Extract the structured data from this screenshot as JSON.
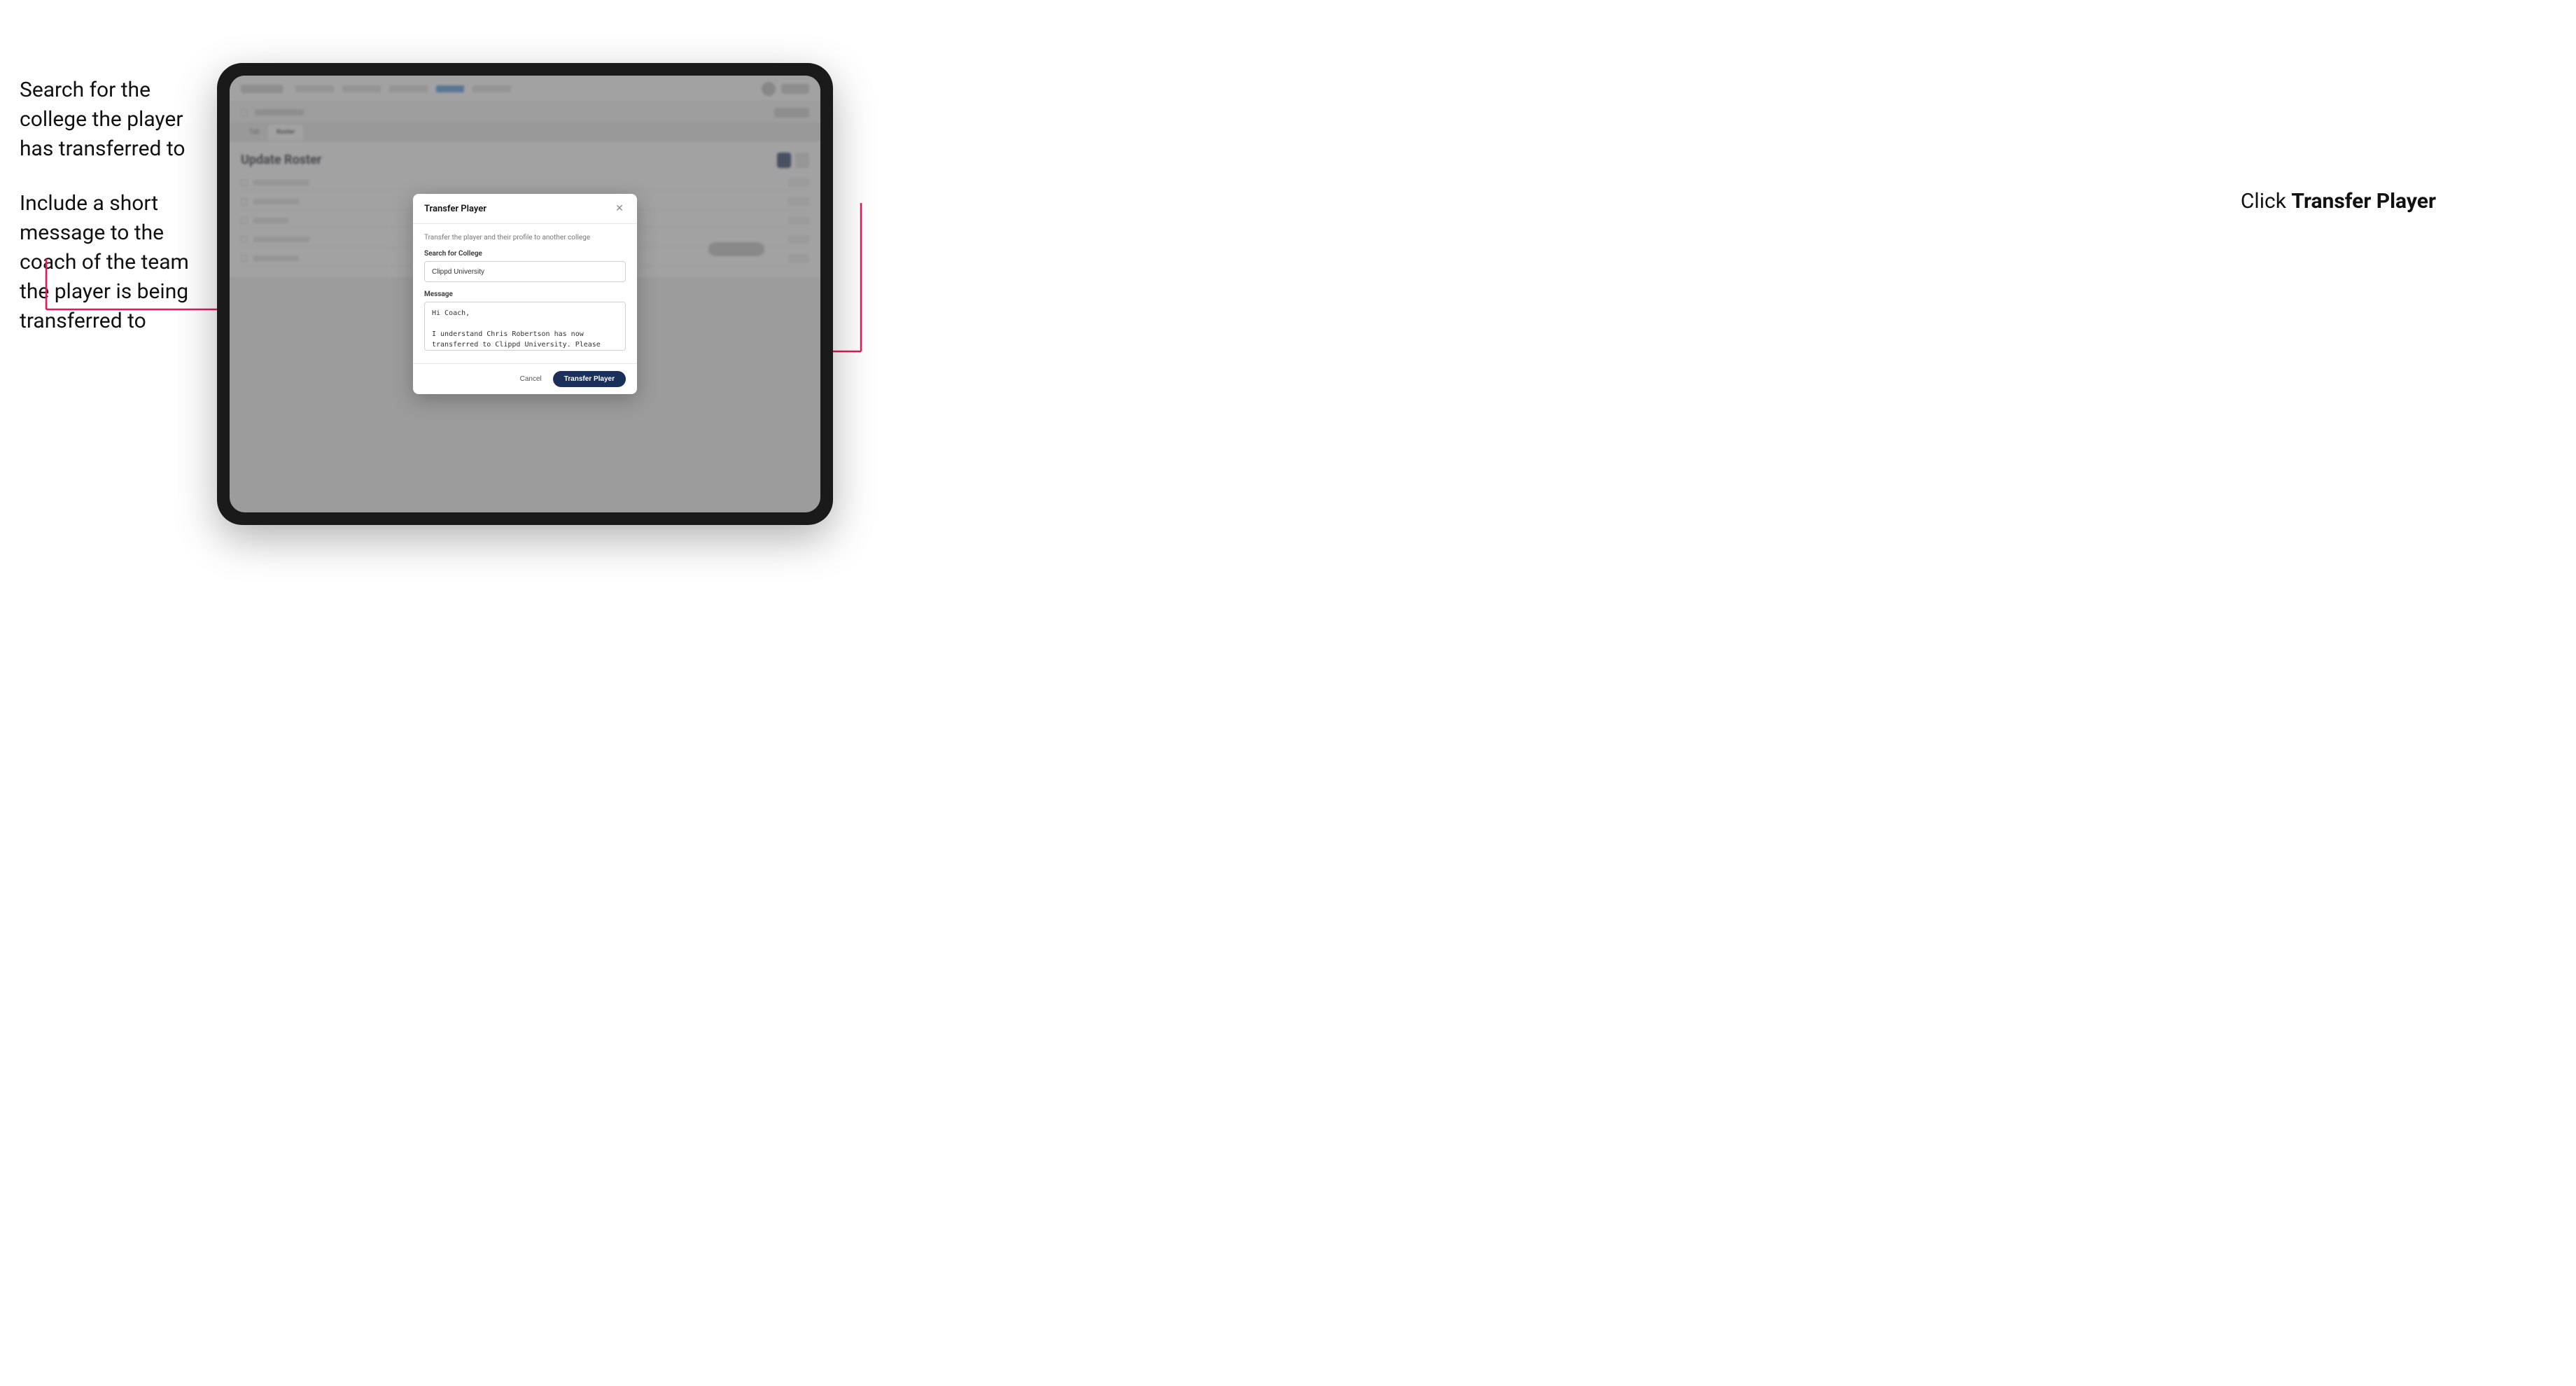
{
  "annotations": {
    "left_top": "Search for the college the player has transferred to",
    "left_bottom": "Include a short message to the coach of the team the player is being transferred to",
    "right": "Click",
    "right_bold": "Transfer Player"
  },
  "modal": {
    "title": "Transfer Player",
    "subtitle": "Transfer the player and their profile to another college",
    "search_label": "Search for College",
    "search_value": "Clippd University",
    "message_label": "Message",
    "message_value": "Hi Coach,\n\nI understand Chris Robertson has now transferred to Clippd University. Please accept this transfer request when you can.",
    "cancel_btn": "Cancel",
    "transfer_btn": "Transfer Player"
  },
  "nav": {
    "logo": "",
    "active_tab": "Roster"
  },
  "content": {
    "title": "Update Roster"
  }
}
